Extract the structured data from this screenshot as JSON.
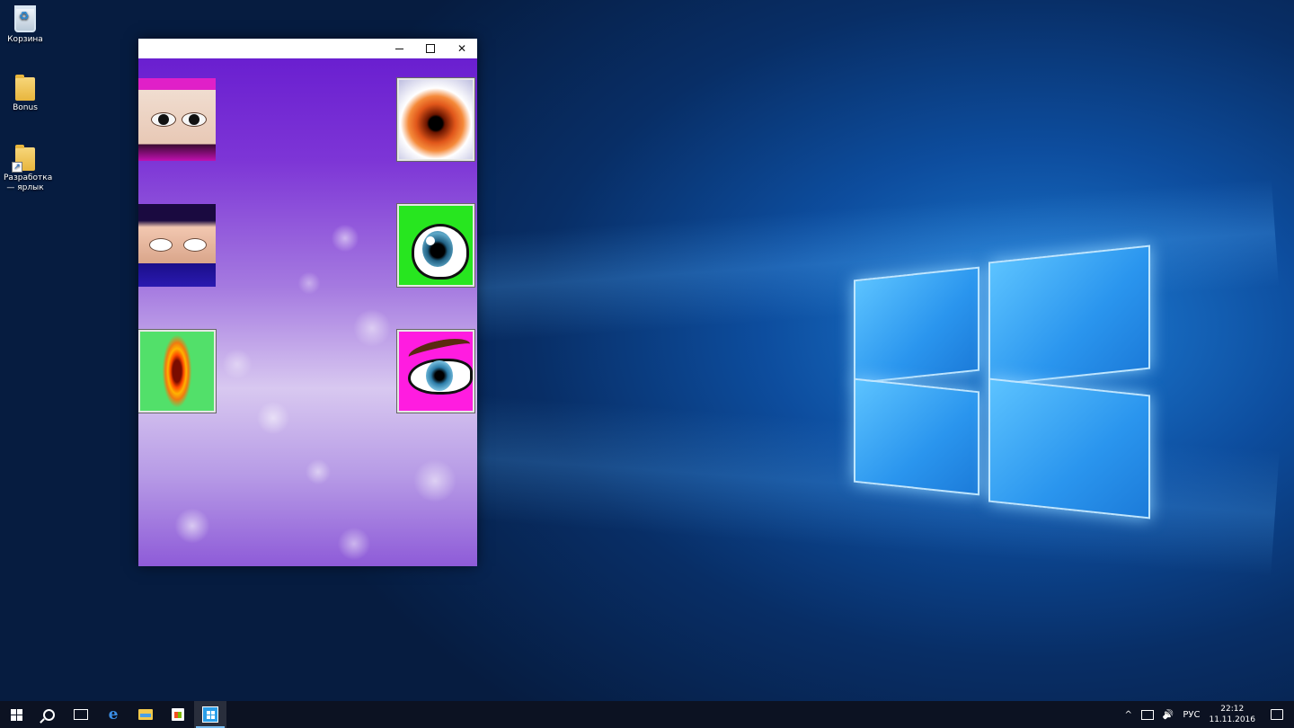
{
  "desktop": {
    "icons": [
      {
        "label": "Корзина",
        "icon": "recycle-bin-icon"
      },
      {
        "label": "Bonus",
        "icon": "folder-icon"
      },
      {
        "label": "Разработка — ярлык",
        "icon": "folder-shortcut-icon"
      }
    ]
  },
  "window": {
    "title": "",
    "controls": {
      "minimize": "—",
      "maximize": "☐",
      "close": "✕"
    },
    "tiles": [
      {
        "name": "human-eyes-dark",
        "icon": "human-eyes-image"
      },
      {
        "name": "fire-eye",
        "icon": "fire-eye-image"
      },
      {
        "name": "white-eyes",
        "icon": "white-eyes-image"
      },
      {
        "name": "anime-eye-green",
        "icon": "anime-eye-green-image"
      },
      {
        "name": "dragon-eye",
        "icon": "dragon-eye-image"
      },
      {
        "name": "anime-eye-pink",
        "icon": "anime-eye-pink-image"
      }
    ]
  },
  "taskbar": {
    "language": "РУС",
    "time": "22:12",
    "date": "11.11.2016",
    "tray_chevron": "^",
    "volume_glyph": "🔊"
  },
  "colors": {
    "desktop_blue": "#0d4d9e",
    "taskbar_bg": "#0c1222",
    "accent": "#76b9ed"
  }
}
